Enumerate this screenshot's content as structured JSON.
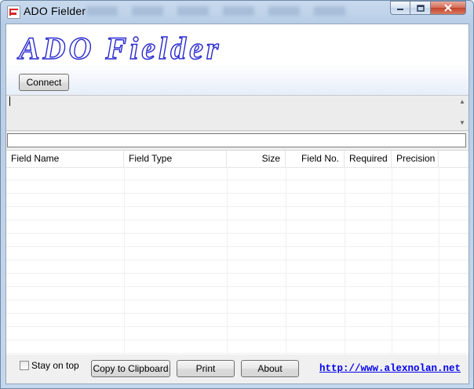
{
  "window": {
    "title": "ADO Fielder"
  },
  "banner": {
    "logo_text": "ADO Fielder"
  },
  "toolbar": {
    "connect_label": "Connect"
  },
  "memo": {
    "text": ""
  },
  "query": {
    "value": ""
  },
  "table": {
    "columns": [
      "Field Name",
      "Field Type",
      "Size",
      "Field No.",
      "Required",
      "Precision"
    ],
    "rows": []
  },
  "footer": {
    "stay_on_top_label": "Stay on top",
    "stay_on_top_checked": false,
    "copy_label": "Copy to Clipboard",
    "print_label": "Print",
    "about_label": "About",
    "link_text": "http://www.alexnolan.net"
  },
  "colors": {
    "link": "#0000ee",
    "logo_stroke": "#2a2ad0",
    "close": "#c2442b"
  },
  "icons": [
    "app-icon",
    "minimize-icon",
    "maximize-icon",
    "close-icon",
    "scroll-up-icon",
    "scroll-down-icon"
  ]
}
